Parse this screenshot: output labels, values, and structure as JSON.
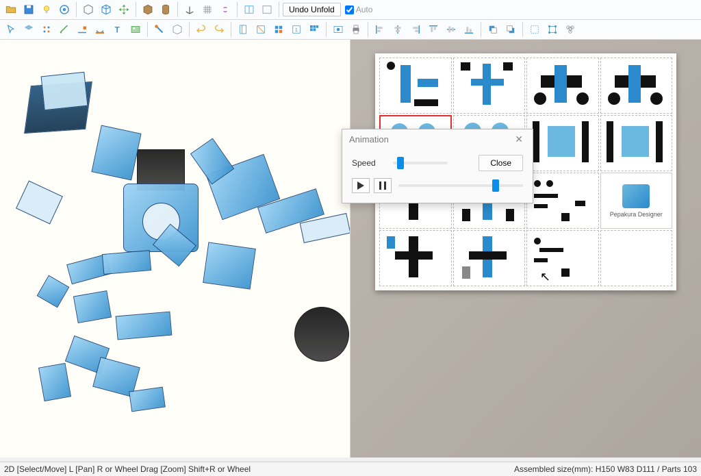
{
  "toolbar1": {
    "icons": [
      "folder-open",
      "save",
      "lightbulb",
      "texture",
      "3d-box",
      "cube-outline",
      "move-arrows",
      "cube-solid",
      "cylinder",
      "axis",
      "grid",
      "link"
    ],
    "view_icons": [
      "split-vertical",
      "panel-single"
    ],
    "undo_btn": "Undo Unfold",
    "auto_label": "Auto"
  },
  "toolbar2": {
    "icons": [
      "select-poly",
      "select-face",
      "vertex-tool",
      "measure",
      "line-color",
      "fill-color",
      "text",
      "image",
      "paint",
      "cube-wire",
      "undo",
      "redo"
    ],
    "icons2": [
      "page-open",
      "page-fold",
      "page-grid",
      "page-num",
      "grid-all",
      "export-img",
      "print"
    ],
    "icons3": [
      "align-left",
      "align-center",
      "align-right",
      "align-top",
      "align-middle",
      "align-bottom"
    ],
    "icons4": [
      "layer",
      "layer-back",
      "bounds",
      "transform",
      "group"
    ]
  },
  "dialog": {
    "title": "Animation",
    "speed_label": "Speed",
    "close_btn": "Close"
  },
  "panel2d": {
    "logo_text": "Pepakura Designer"
  },
  "statusbar": {
    "left": "2D [Select/Move] L [Pan] R or Wheel Drag [Zoom] Shift+R or Wheel",
    "right": "Assembled size(mm): H150 W83 D111 / Parts 103"
  }
}
